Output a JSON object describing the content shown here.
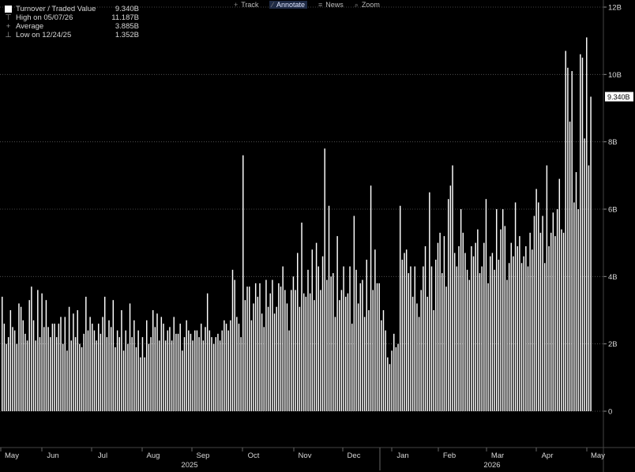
{
  "toolbar": {
    "items": [
      {
        "label": "Track",
        "icon": "plus-icon"
      },
      {
        "label": "Annotate",
        "icon": "pencil-icon"
      },
      {
        "label": "News",
        "icon": "news-icon"
      },
      {
        "label": "Zoom",
        "icon": "zoom-icon"
      }
    ]
  },
  "legend": {
    "series_label": "Turnover / Traded Value",
    "series_value": "9.340B",
    "high_label": "High on 05/07/26",
    "high_value": "11.187B",
    "avg_label": "Average",
    "avg_value": "3.885B",
    "low_label": "Low on 12/24/25",
    "low_value": "1.352B"
  },
  "colors": {
    "background": "#000000",
    "bars": "#ffffff",
    "grid": "#5a5a5a",
    "text": "#d8d8d8"
  },
  "chart_data": {
    "type": "bar",
    "ylim": [
      0,
      12
    ],
    "y_unit": "B",
    "y_ticks": [
      "0",
      "2B",
      "4B",
      "6B",
      "8B",
      "10B",
      "12B"
    ],
    "grid": "horizontal dotted",
    "last_value_label": "9.340B",
    "x_month_labels": [
      "May",
      "Jun",
      "Jul",
      "Aug",
      "Sep",
      "Oct",
      "Nov",
      "Dec",
      "Jan",
      "Feb",
      "Mar",
      "Apr",
      "May"
    ],
    "x_year_labels": [
      "2025",
      "2026"
    ],
    "values": [
      3.4,
      2.6,
      2.0,
      2.2,
      3.0,
      2.5,
      2.4,
      2.0,
      3.2,
      3.1,
      2.7,
      2.3,
      2.1,
      3.3,
      3.7,
      2.7,
      2.1,
      3.6,
      2.2,
      3.5,
      2.5,
      3.3,
      2.5,
      2.2,
      2.6,
      2.6,
      2.2,
      2.6,
      2.8,
      2.0,
      2.8,
      1.8,
      3.1,
      2.1,
      2.9,
      2.2,
      3.0,
      2.0,
      1.9,
      2.3,
      3.4,
      2.4,
      2.8,
      2.6,
      2.4,
      2.1,
      2.6,
      2.3,
      2.8,
      3.4,
      2.2,
      2.7,
      2.5,
      3.3,
      1.9,
      2.4,
      2.2,
      3.0,
      1.8,
      2.4,
      2.0,
      3.2,
      2.2,
      2.7,
      1.9,
      2.4,
      1.6,
      2.2,
      1.6,
      2.7,
      2.0,
      2.2,
      3.0,
      2.5,
      2.9,
      2.1,
      2.8,
      2.6,
      2.1,
      2.4,
      2.5,
      2.1,
      2.8,
      2.3,
      2.3,
      2.6,
      1.8,
      2.2,
      2.7,
      2.4,
      2.3,
      2.1,
      2.4,
      2.4,
      2.2,
      2.6,
      2.1,
      2.5,
      3.5,
      2.4,
      2.2,
      2.0,
      2.2,
      2.3,
      2.1,
      2.4,
      2.7,
      2.6,
      2.4,
      2.7,
      4.2,
      3.9,
      2.8,
      2.6,
      2.2,
      7.6,
      3.3,
      3.7,
      3.7,
      2.7,
      3.2,
      3.8,
      3.4,
      3.8,
      2.9,
      2.5,
      3.9,
      3.1,
      3.5,
      3.9,
      2.9,
      3.1,
      3.8,
      3.7,
      4.3,
      3.6,
      3.2,
      2.4,
      3.6,
      4.0,
      3.6,
      4.7,
      3.1,
      5.6,
      3.5,
      3.4,
      4.2,
      3.5,
      4.8,
      3.3,
      5.0,
      4.3,
      3.6,
      4.6,
      7.8,
      3.9,
      6.1,
      4.0,
      4.1,
      2.8,
      5.2,
      3.3,
      3.6,
      4.3,
      3.4,
      3.5,
      4.3,
      2.6,
      5.8,
      4.2,
      3.2,
      3.8,
      3.9,
      2.8,
      4.5,
      3.0,
      6.7,
      3.6,
      4.8,
      3.8,
      3.8,
      2.7,
      3.0,
      2.4,
      1.6,
      1.4,
      1.8,
      2.3,
      1.9,
      2.0,
      6.1,
      4.5,
      4.7,
      4.8,
      4.1,
      4.3,
      3.4,
      4.3,
      3.2,
      2.8,
      3.6,
      4.3,
      4.9,
      3.4,
      6.5,
      4.3,
      3.0,
      4.5,
      5.0,
      5.3,
      4.1,
      5.2,
      3.7,
      6.3,
      6.7,
      7.3,
      4.7,
      4.3,
      4.9,
      6.0,
      5.3,
      4.7,
      4.2,
      3.9,
      4.9,
      4.6,
      5.0,
      5.4,
      4.1,
      4.3,
      5.0,
      6.3,
      3.8,
      4.6,
      4.7,
      4.2,
      6.0,
      4.5,
      5.4,
      6.0,
      5.5,
      3.9,
      4.4,
      5.0,
      4.6,
      6.2,
      4.9,
      5.2,
      4.4,
      4.6,
      4.9,
      4.3,
      5.3,
      4.8,
      5.8,
      6.6,
      6.2,
      5.3,
      5.8,
      4.4,
      7.3,
      4.9,
      5.3,
      5.9,
      5.2,
      6.0,
      6.9,
      5.4,
      5.3,
      10.7,
      10.2,
      8.6,
      10.1,
      6.2,
      7.1,
      6.0,
      10.6,
      10.5,
      8.1,
      11.1,
      7.3,
      9.34
    ]
  }
}
